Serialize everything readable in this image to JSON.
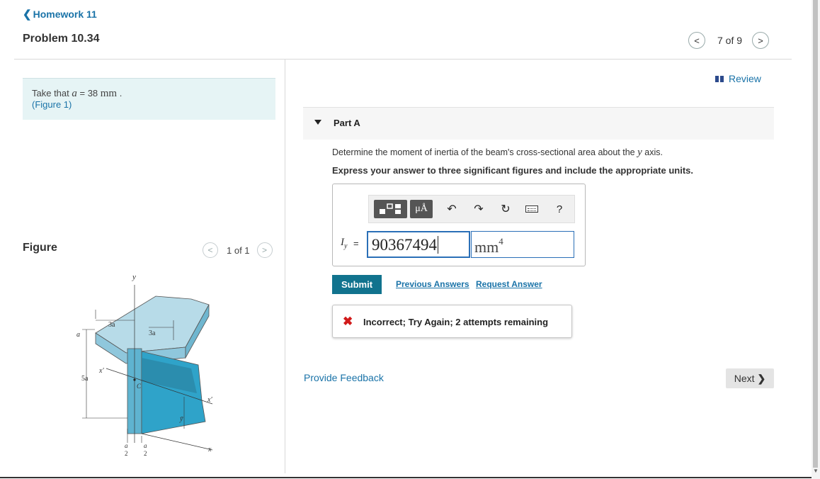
{
  "nav": {
    "back_label": "Homework 11",
    "problem_title": "Problem 10.34",
    "pager_text": "7 of 9"
  },
  "given": {
    "prefix": "Take that ",
    "var": "a",
    "eq": " = 38 ",
    "unit": "mm",
    "suffix": " .",
    "figure_link": "(Figure 1)"
  },
  "figure_panel": {
    "heading": "Figure",
    "pager_text": "1 of 1",
    "labels": {
      "y": "y",
      "three_a_1": "3a",
      "three_a_2": "3a",
      "a_left": "a",
      "five_a": "5a",
      "x_prime_left": "x′",
      "x_prime_right": "x′",
      "c_label": "C",
      "y_bar": "ȳ",
      "x": "x",
      "half_a_num": "a",
      "half_a_den": "2"
    }
  },
  "review_label": "Review",
  "part": {
    "title": "Part A",
    "question_prefix": "Determine the moment of inertia of the beam's cross-sectional area about the ",
    "question_var": "y",
    "question_suffix": " axis.",
    "instruction": "Express your answer to three significant figures and include the appropriate units."
  },
  "toolbar": {
    "units_label": "μÅ",
    "undo_icon": "undo-icon",
    "redo_icon": "redo-icon",
    "reset_icon": "reset-icon",
    "keyboard_icon": "keyboard-icon",
    "help_label": "?"
  },
  "answer": {
    "var_symbol": "I",
    "var_sub": "y",
    "equals": "=",
    "value": "90367494",
    "unit": "mm",
    "unit_exp": "4"
  },
  "actions": {
    "submit_label": "Submit",
    "previous_answers_label": "Previous Answers",
    "request_answer_label": "Request Answer",
    "provide_feedback_label": "Provide Feedback",
    "next_label": "Next"
  },
  "feedback": {
    "icon": "✖",
    "text": "Incorrect; Try Again; 2 attempts remaining"
  },
  "colors": {
    "accent": "#11738e",
    "link": "#1a73a8",
    "error": "#d11a1a",
    "given_bg": "#e6f4f5"
  }
}
